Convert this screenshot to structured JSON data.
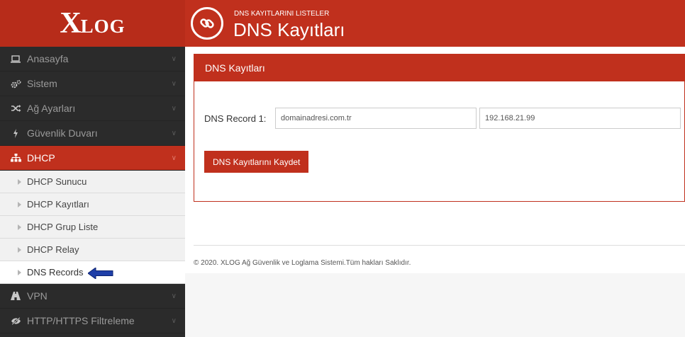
{
  "brand": {
    "logo_big": "X",
    "logo_small": "LOG"
  },
  "header": {
    "subtitle": "DNS KAYITLARINI LISTELER",
    "title": "DNS Kayıtları",
    "icon": "link-icon"
  },
  "sidebar": {
    "items": [
      {
        "label": "Anasayfa",
        "icon": "laptop-icon"
      },
      {
        "label": "Sistem",
        "icon": "cogs-icon"
      },
      {
        "label": "Ağ Ayarları",
        "icon": "random-icon"
      },
      {
        "label": "Güvenlik Duvarı",
        "icon": "bolt-icon"
      },
      {
        "label": "DHCP",
        "icon": "sitemap-icon"
      },
      {
        "label": "VPN",
        "icon": "road-icon"
      },
      {
        "label": "HTTP/HTTPS Filtreleme",
        "icon": "eye-slash-icon"
      }
    ],
    "dhcp_sub": [
      {
        "label": "DHCP Sunucu"
      },
      {
        "label": "DHCP Kayıtları"
      },
      {
        "label": "DHCP Grup Liste"
      },
      {
        "label": "DHCP Relay"
      },
      {
        "label": "DNS Records"
      }
    ]
  },
  "panel": {
    "title": "DNS Kayıtları",
    "record_label": "DNS Record 1:",
    "domain_value": "domainadresi.com.tr",
    "ip_value": "192.168.21.99",
    "save_label": "DNS Kayıtlarını Kaydet"
  },
  "footer": {
    "text": "© 2020. XLOG Ağ Güvenlik ve Loglama Sistemi.Tüm hakları Saklıdır."
  },
  "colors": {
    "accent": "#c0301d",
    "sidebar_bg": "#2b2b2b",
    "annotation_arrow": "#1f3fa8"
  }
}
